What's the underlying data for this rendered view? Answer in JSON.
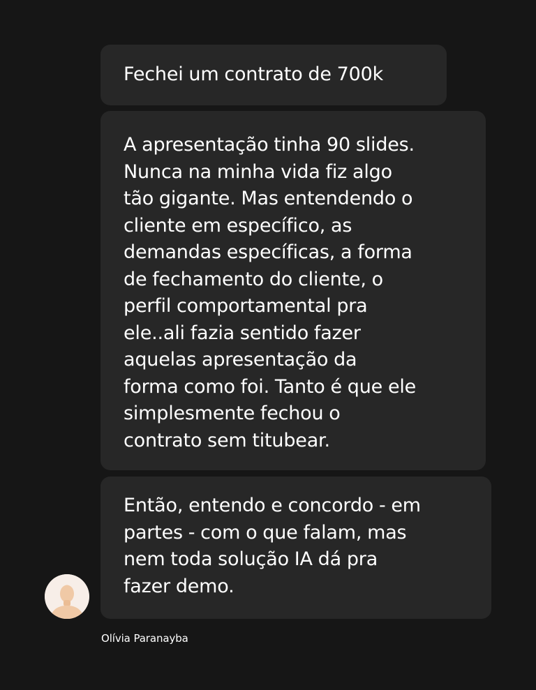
{
  "messages": [
    {
      "text": "Fechei um contrato de 700k"
    },
    {
      "text": "A apresentação tinha 90 slides.\nNunca na minha vida fiz algo\ntão gigante. Mas entendendo o\ncliente em específico, as\ndemandas específicas, a forma\nde fechamento do cliente, o\nperfil comportamental pra\nele..ali fazia sentido fazer\naquelas apresentação da\nforma como foi. Tanto é que ele\nsimplesmente fechou o\ncontrato sem titubear."
    },
    {
      "text": "Então, entendo e concordo - em\npartes - com o que falam, mas\nnem toda solução IA dá pra\nfazer demo."
    }
  ],
  "sender": {
    "name": "Olívia Paranayba",
    "avatar_icon": "default-person-avatar-icon",
    "avatar_bg": "#f7eee8",
    "avatar_figure": "#f0c9a6"
  },
  "colors": {
    "background": "#161616",
    "bubble": "#272727",
    "text": "#ffffff"
  }
}
